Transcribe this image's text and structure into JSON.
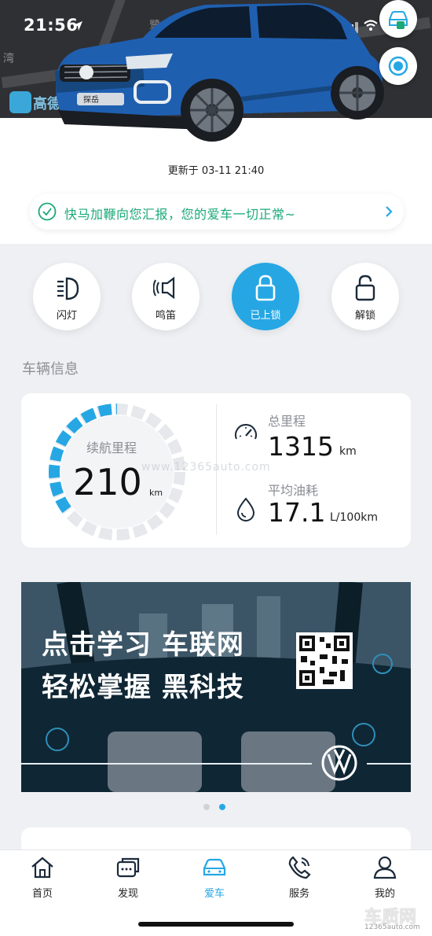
{
  "status_bar": {
    "time": "21:56"
  },
  "map": {
    "labels": [
      "鹭",
      "湾"
    ],
    "logo_text": "高德"
  },
  "vehicle": {
    "updated_text": "更新于 03-11 21:40",
    "badge_text": "探岳"
  },
  "notice": {
    "text": "快马加鞭向您汇报，您的爱车一切正常~",
    "accent": "#1aa977"
  },
  "actions": [
    {
      "label": "闪灯",
      "icon": "headlight-icon"
    },
    {
      "label": "鸣笛",
      "icon": "horn-icon"
    },
    {
      "label": "已上锁",
      "icon": "locked-icon",
      "active": true
    },
    {
      "label": "解锁",
      "icon": "unlock-icon"
    }
  ],
  "vehicle_info": {
    "section_title": "车辆信息",
    "range_label": "续航里程",
    "range_value": "210",
    "range_unit": "km",
    "mileage_label": "总里程",
    "mileage_value": "1315",
    "mileage_unit": "km",
    "fuel_label": "平均油耗",
    "fuel_value": "17.1",
    "fuel_unit": "L/100km"
  },
  "banner": {
    "line1": "点击学习 车联网",
    "line2": "轻松掌握 黑科技"
  },
  "carousel": {
    "count": 2,
    "active_index": 1
  },
  "tabs": [
    {
      "label": "首页",
      "icon": "home-icon"
    },
    {
      "label": "发现",
      "icon": "discover-icon"
    },
    {
      "label": "爱车",
      "icon": "car-icon",
      "active": true
    },
    {
      "label": "服务",
      "icon": "phone-icon"
    },
    {
      "label": "我的",
      "icon": "profile-icon"
    }
  ],
  "watermark": {
    "center": "www.12365auto.com",
    "brand": "车质网",
    "brand_url": "12365auto.com"
  },
  "colors": {
    "accent": "#26a7e4",
    "car_blue": "#1f5fb0"
  }
}
